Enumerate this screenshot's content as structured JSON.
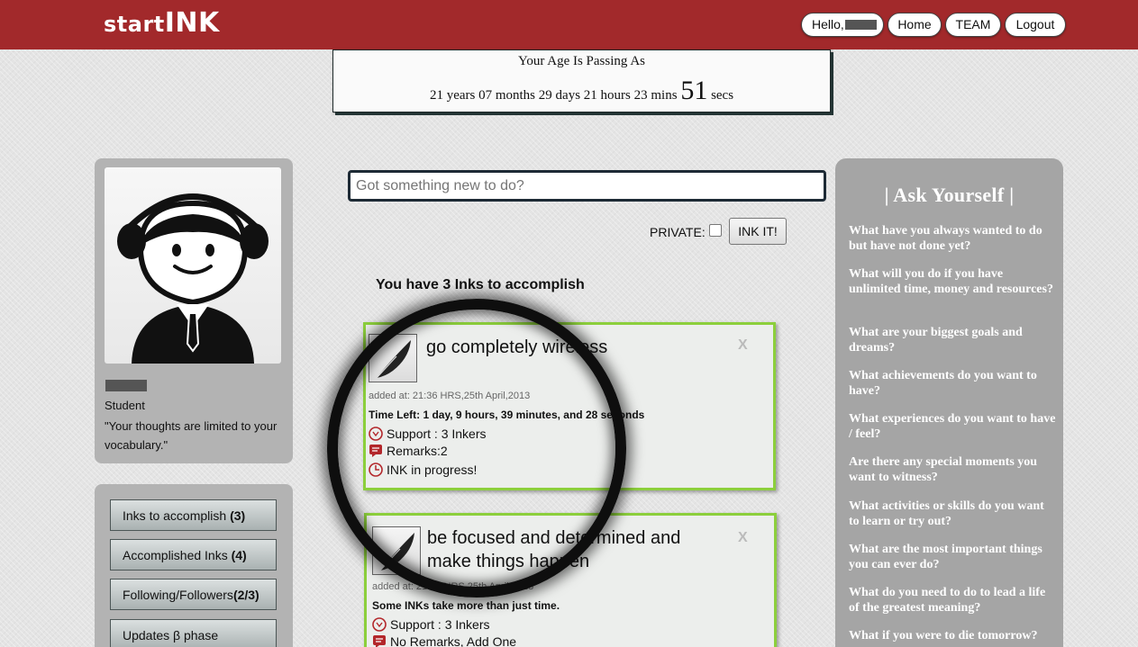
{
  "header": {
    "logo_part1": "start",
    "logo_part2": "INK",
    "hello_label": "Hello,",
    "home_label": "Home",
    "team_label": "TEAM",
    "logout_label": "Logout"
  },
  "age": {
    "title": "Your Age Is Passing As",
    "years": "21",
    "months": "07",
    "days": "29",
    "hours": "21",
    "mins": "23",
    "secs": "51",
    "years_unit": "years",
    "months_unit": "months",
    "days_unit": "days",
    "hours_unit": "hours",
    "mins_unit": "mins",
    "secs_unit": "secs"
  },
  "profile": {
    "role": "Student",
    "quote": "\"Your thoughts are limited to your vocabulary.\""
  },
  "nav": {
    "items": [
      {
        "label": "Inks to accomplish",
        "count": "(3)"
      },
      {
        "label": "Accomplished Inks",
        "count": "(4)"
      },
      {
        "label": "Following/Followers",
        "count": "(2/3)"
      },
      {
        "label": "Updates β phase",
        "count": ""
      }
    ]
  },
  "composer": {
    "placeholder": "Got something new to do?",
    "private_label": "PRIVATE:",
    "private_checked": false,
    "submit_label": "INK IT!"
  },
  "inks_heading": "You have 3 Inks to accomplish",
  "inks": [
    {
      "title": "go completely wireless",
      "close": "X",
      "added": "added at: 21:36 HRS,25th April,2013",
      "time_left": "Time Left: 1 day, 9 hours, 39 minutes, and 28 seconds",
      "support": "Support : 3 Inkers",
      "remarks": "Remarks:2",
      "status": "INK in progress!"
    },
    {
      "title": "be focused and determined and make things happen",
      "close": "X",
      "added": "added at: 21:36 HRS,25th April,2013",
      "time_left": "Some INKs take more than just time.",
      "support": "Support : 3 Inkers",
      "remarks": "No Remarks, Add One"
    }
  ],
  "ask": {
    "title": "| Ask Yourself |",
    "questions": [
      "What have you always wanted to do but have not done yet?",
      "What will you do if you have unlimited time, money and resources?",
      "What are your biggest goals and dreams?",
      "What achievements do you want to have?",
      "What experiences do you want to have / feel?",
      "Are there any special moments you want to witness?",
      "What activities or skills do you want to learn or try out?",
      "What are the most important things you can ever do?",
      "What do you need to do to lead a life of the greatest meaning?",
      "What if you were to die tomorrow?"
    ]
  },
  "colors": {
    "header_bg": "#a2292b",
    "ink_border": "#8ccf3c",
    "ask_panel_bg": "#a5a5a5",
    "side_panel_bg": "#b3b3b3",
    "icon_red": "#b3272b"
  },
  "icons": [
    "feather-quill-icon",
    "support-icon",
    "remarks-icon",
    "clock-icon",
    "avatar-headphones-illustration"
  ]
}
